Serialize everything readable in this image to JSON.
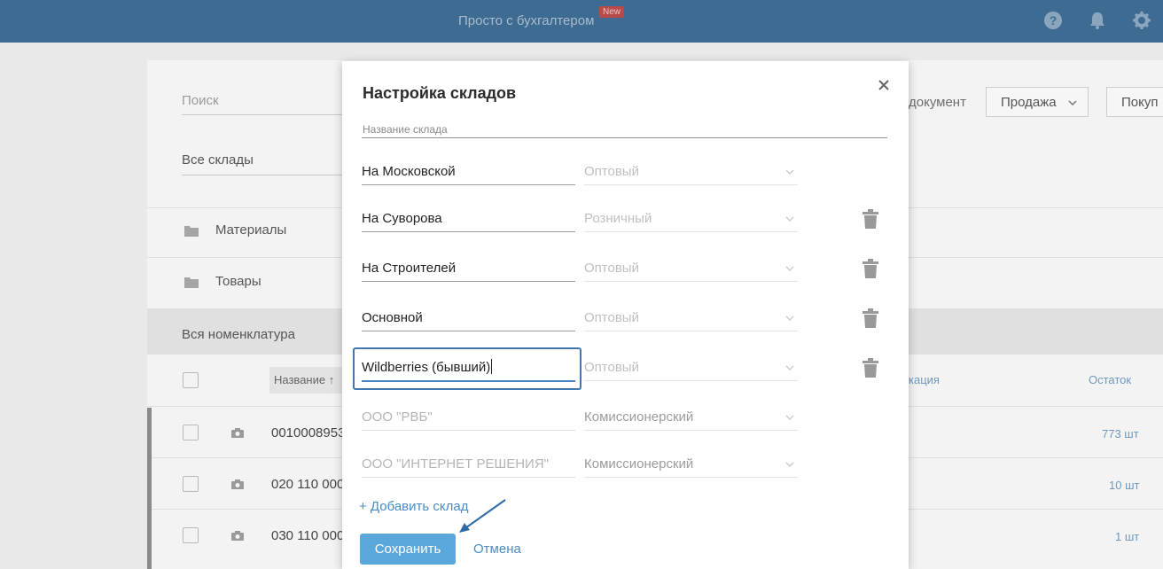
{
  "topbar": {
    "title": "Просто с бухгалтером",
    "badge": "New",
    "icons": [
      "help-icon",
      "bell-icon",
      "gear-icon"
    ]
  },
  "background": {
    "search_placeholder": "Поиск",
    "warehouse_filter": "Все склады",
    "doc_label": "документ",
    "sale_button": "Продажа",
    "purchase_button": "Покуп",
    "folders": [
      "Материалы",
      "Товары"
    ],
    "all_items": "Вся номенклатура",
    "columns": {
      "name": "Название ↑",
      "spec": "кация",
      "rest": "Остаток"
    },
    "rows": [
      {
        "code": "0010008953",
        "rest": "773 шт"
      },
      {
        "code": "020 110 000",
        "rest": "10 шт"
      },
      {
        "code": "030 110 000",
        "rest": "1 шт"
      }
    ]
  },
  "modal": {
    "title": "Настройка складов",
    "column_name": "Название склада",
    "warehouses": [
      {
        "name": "На Московской",
        "type": "Оптовый"
      },
      {
        "name": "На Суворова",
        "type": "Розничный"
      },
      {
        "name": "На Строителей",
        "type": "Оптовый"
      },
      {
        "name": "Основной",
        "type": "Оптовый"
      },
      {
        "name": "Wildberries (бывший)",
        "type": "Оптовый"
      },
      {
        "name": "ООО \"РВБ\"",
        "type": "Комиссионерский"
      },
      {
        "name": "ООО \"ИНТЕРНЕТ РЕШЕНИЯ\"",
        "type": "Комиссионерский"
      }
    ],
    "add_link": "+ Добавить склад",
    "save_button": "Сохранить",
    "cancel_link": "Отмена"
  },
  "colors": {
    "topbar": "#3e6b91",
    "accent": "#5aa7dc",
    "link": "#4a8cc6",
    "focus": "#3c78b5"
  }
}
